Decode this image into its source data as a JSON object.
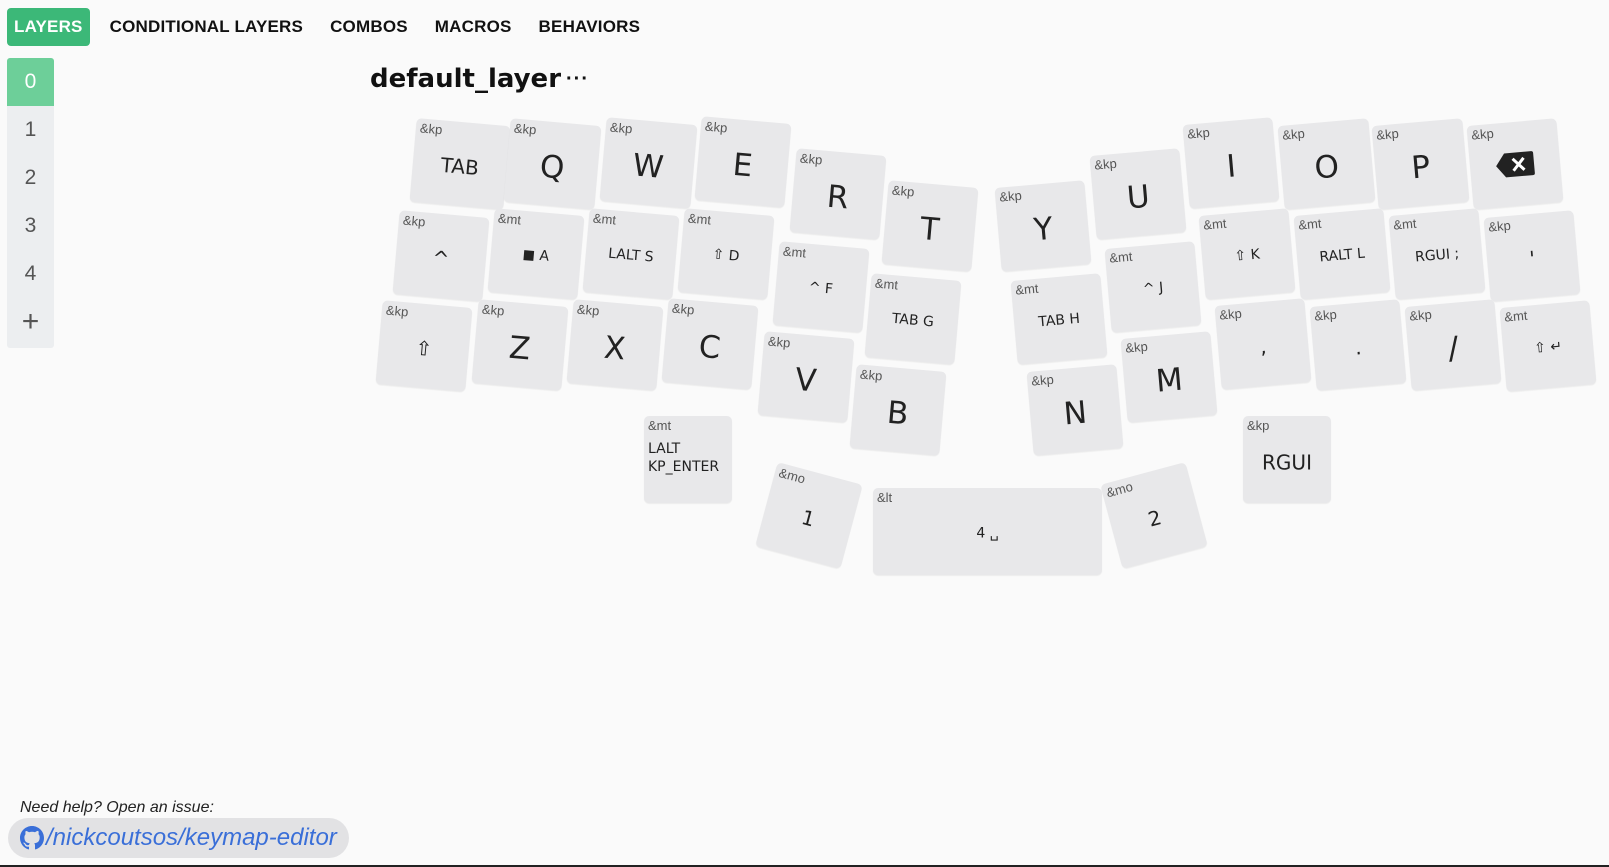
{
  "tabs": [
    {
      "label": "LAYERS",
      "active": true
    },
    {
      "label": "CONDITIONAL LAYERS"
    },
    {
      "label": "COMBOS"
    },
    {
      "label": "MACROS"
    },
    {
      "label": "BEHAVIORS"
    }
  ],
  "layers": [
    "0",
    "1",
    "2",
    "3",
    "4"
  ],
  "add_layer_label": "+",
  "layer_title": "default_layer",
  "layer_menu": "···",
  "keys": [
    {
      "b": "&kp",
      "l": "TAB",
      "s": "sm"
    },
    {
      "b": "&kp",
      "l": "Q"
    },
    {
      "b": "&kp",
      "l": "W"
    },
    {
      "b": "&kp",
      "l": "E"
    },
    {
      "b": "&kp",
      "l": "R"
    },
    {
      "b": "&kp",
      "l": "T"
    },
    {
      "b": "&kp",
      "l": "Y"
    },
    {
      "b": "&kp",
      "l": "U"
    },
    {
      "b": "&kp",
      "l": "I"
    },
    {
      "b": "&kp",
      "l": "O"
    },
    {
      "b": "&kp",
      "l": "P"
    },
    {
      "b": "&kp",
      "l": "",
      "icon": "backspace-icon"
    },
    {
      "b": "&kp",
      "l": "^",
      "s": "sm"
    },
    {
      "b": "&mt",
      "l": "A",
      "s": "xs",
      "icon": "windows-icon"
    },
    {
      "b": "&mt",
      "l": "LALT S",
      "s": "xs"
    },
    {
      "b": "&mt",
      "l": "⇧ D",
      "s": "xs"
    },
    {
      "b": "&mt",
      "l": "^ F",
      "s": "xs"
    },
    {
      "b": "&mt",
      "l": "TAB G",
      "s": "xs"
    },
    {
      "b": "&mt",
      "l": "TAB H",
      "s": "xs"
    },
    {
      "b": "&mt",
      "l": "^ J",
      "s": "xs"
    },
    {
      "b": "&mt",
      "l": "⇧ K",
      "s": "xs"
    },
    {
      "b": "&mt",
      "l": "RALT L",
      "s": "xs"
    },
    {
      "b": "&mt",
      "l": "RGUI ;",
      "s": "xs"
    },
    {
      "b": "&kp",
      "l": "'",
      "s": "sm"
    },
    {
      "b": "&kp",
      "l": "⇧",
      "s": "sm"
    },
    {
      "b": "&kp",
      "l": "Z"
    },
    {
      "b": "&kp",
      "l": "X"
    },
    {
      "b": "&kp",
      "l": "C"
    },
    {
      "b": "&kp",
      "l": "V"
    },
    {
      "b": "&kp",
      "l": "B"
    },
    {
      "b": "&kp",
      "l": "N"
    },
    {
      "b": "&kp",
      "l": "M"
    },
    {
      "b": "&kp",
      "l": ",",
      "s": "sm"
    },
    {
      "b": "&kp",
      "l": ".",
      "s": "sm"
    },
    {
      "b": "&kp",
      "l": "/"
    },
    {
      "b": "&mt",
      "l": "⇧ ↵",
      "s": "xs"
    },
    {
      "b": "&mt",
      "l": "LALT\nKP_ENTER",
      "s": "left"
    },
    {
      "b": "&mo",
      "l": "1",
      "s": "sm"
    },
    {
      "b": "&lt",
      "l": "4 ␣",
      "s": "xs"
    },
    {
      "b": "&mo",
      "l": "2",
      "s": "sm"
    },
    {
      "b": "&kp",
      "l": "RGUI",
      "s": "sm"
    }
  ],
  "help_text": "Need help? Open an issue:",
  "github_link": "/nickcoutsos/keymap-editor",
  "colors": {
    "accent": "#3cb878",
    "layer_active": "#6dcf99",
    "key_bg": "#e8e8ea",
    "link": "#3a6fd8"
  }
}
